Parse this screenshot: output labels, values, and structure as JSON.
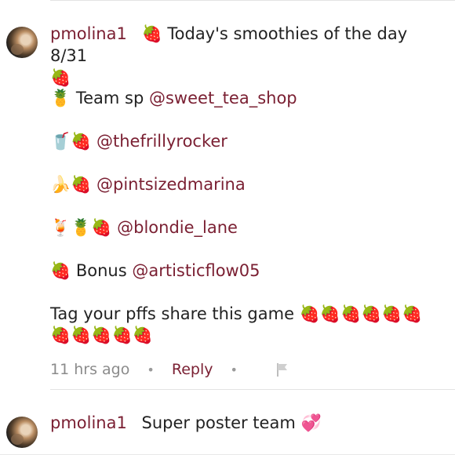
{
  "comments": [
    {
      "username": "pmolina1",
      "intro": {
        "emoji": "🍓",
        "text": "Today's smoothies of the day 8/31",
        "trailing_emoji": "🍓"
      },
      "lines": [
        {
          "emoji": "🍍",
          "text": "Team sp",
          "mention": "@sweet_tea_shop"
        },
        {
          "emoji": "🥤🍓",
          "text": "",
          "mention": "@thefrillyrocker"
        },
        {
          "emoji": "🍌🍓",
          "text": "",
          "mention": "@pintsizedmarina"
        },
        {
          "emoji": "🍹🍍🍓",
          "text": "",
          "mention": "@blondie_lane"
        },
        {
          "emoji": "🍓",
          "text": "Bonus",
          "mention": "@artisticflow05"
        }
      ],
      "closing": {
        "text": "Tag your pffs share this game",
        "emoji": "🍓🍓🍓🍓🍓🍓",
        "emoji_line2": "🍓🍓🍓🍓🍓"
      },
      "time": "11 hrs ago",
      "reply_label": "Reply"
    },
    {
      "username": "pmolina1",
      "text": "Super poster team",
      "emoji": "💞"
    }
  ],
  "colors": {
    "accent": "#7a1f32",
    "muted": "#8b8b8b"
  },
  "icons": {
    "flag": "flag-icon",
    "separator": "•"
  }
}
